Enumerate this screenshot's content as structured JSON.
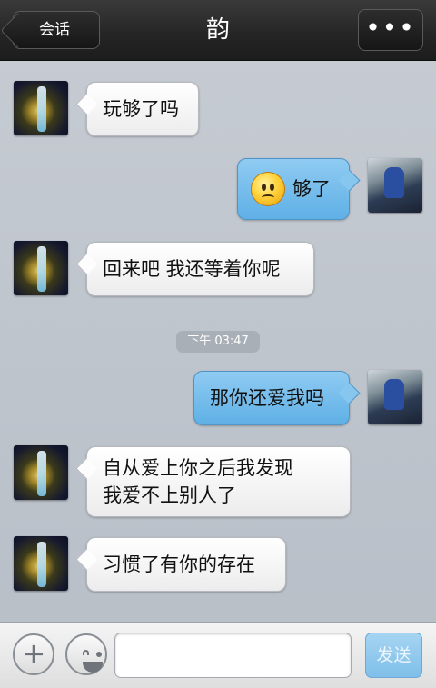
{
  "header": {
    "back_label": "会话",
    "title": "韵",
    "more_label": "•••"
  },
  "messages": [
    {
      "sender": "friend",
      "text": "玩够了吗"
    },
    {
      "sender": "me",
      "emoji": "sad-face-emoji",
      "text": "够了"
    },
    {
      "sender": "friend",
      "text": "回来吧 我还等着你呢"
    },
    {
      "sender": "me",
      "text": "那你还爱我吗"
    },
    {
      "sender": "friend",
      "text": "自从爱上你之后我发现",
      "text2": "我爱不上别人了"
    },
    {
      "sender": "friend",
      "text": "习惯了有你的存在"
    }
  ],
  "timestamp": "下午 03:47",
  "input_bar": {
    "plus_icon": "+",
    "input_value": "",
    "send_label": "发送"
  },
  "colors": {
    "header_bg": "#262626",
    "chat_bg": "#c2c8cf",
    "my_bubble": "#6ab6e9",
    "friend_bubble": "#f4f4f4",
    "send_button": "#8ec8ee"
  }
}
